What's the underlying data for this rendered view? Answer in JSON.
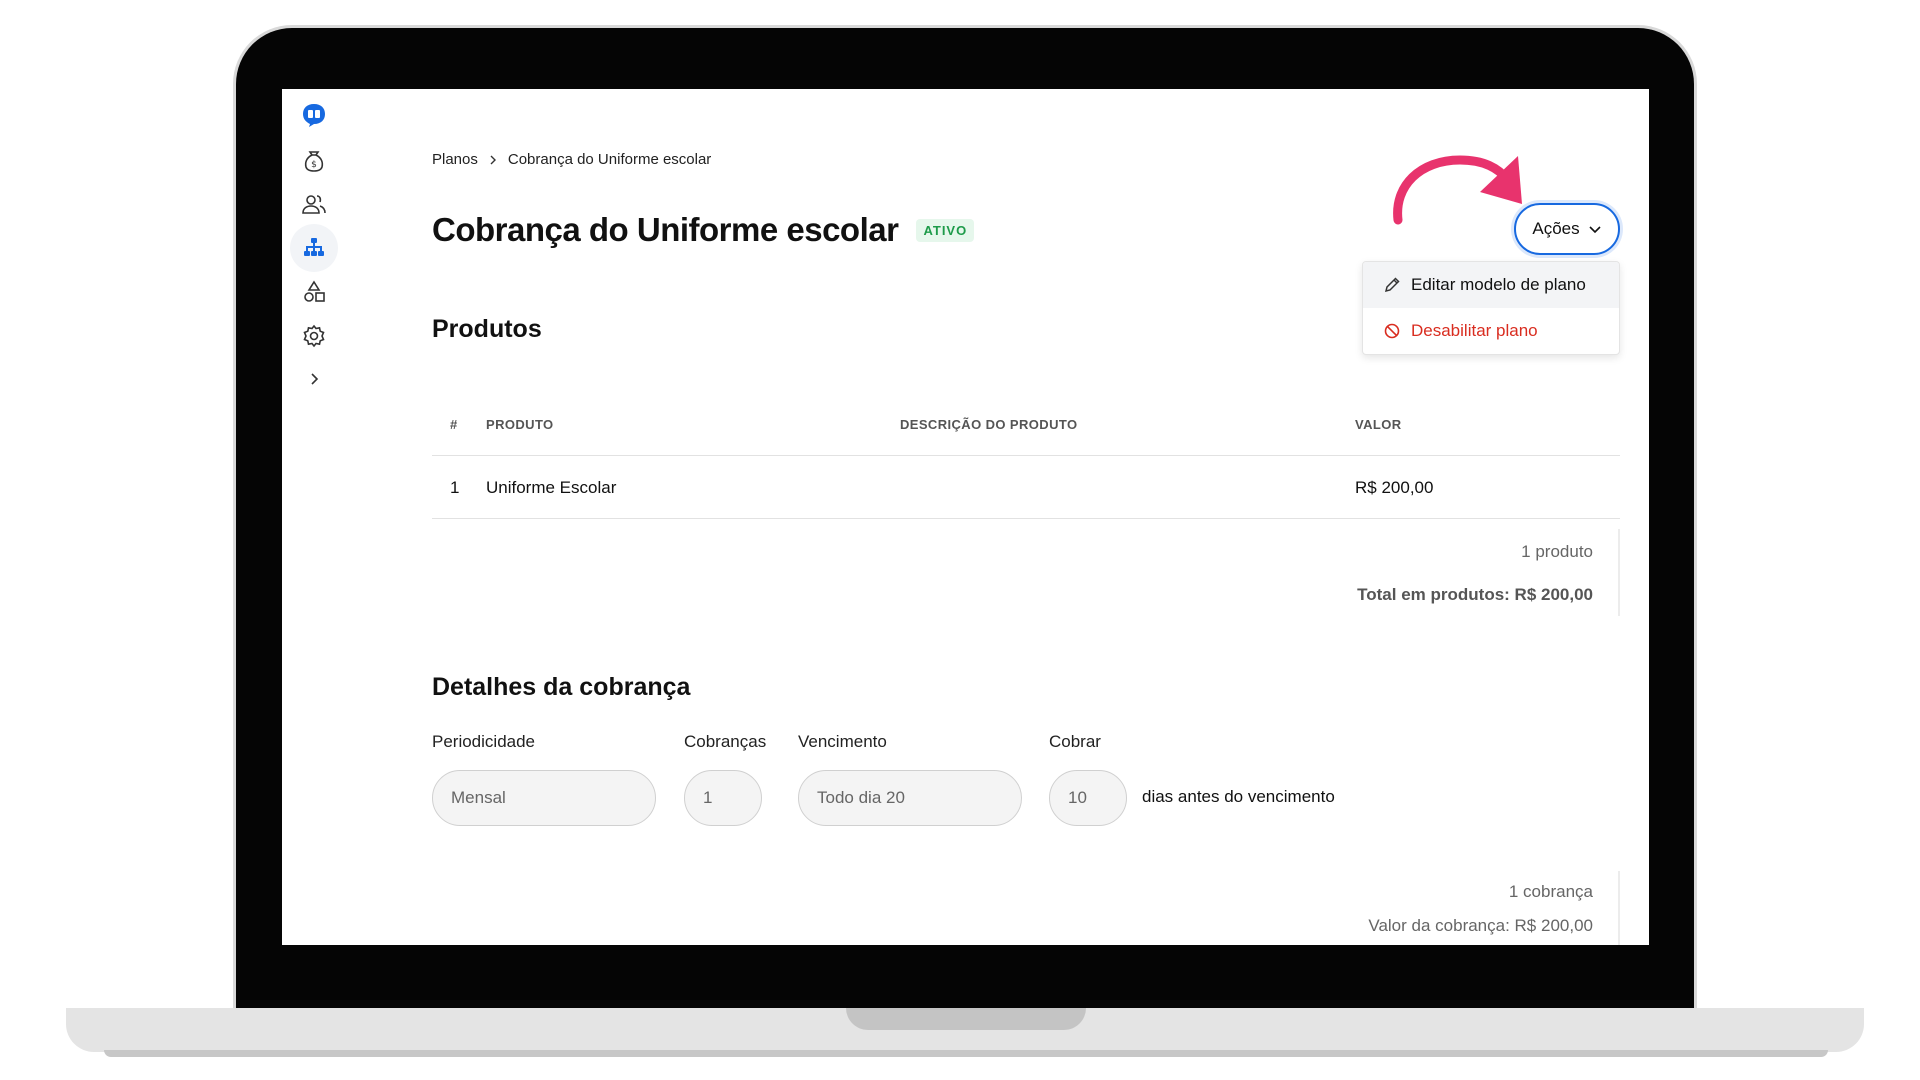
{
  "breadcrumb": {
    "items": [
      "Planos",
      "Cobrança do Uniforme escolar"
    ]
  },
  "page": {
    "title": "Cobrança do Uniforme escolar",
    "status": "ATIVO"
  },
  "actions": {
    "label": "Ações",
    "menu": [
      {
        "label": "Editar modelo de plano",
        "icon": "pencil-icon"
      },
      {
        "label": "Desabilitar plano",
        "icon": "ban-icon"
      }
    ]
  },
  "products": {
    "title": "Produtos",
    "columns": [
      "#",
      "PRODUTO",
      "DESCRIÇÃO DO PRODUTO",
      "VALOR"
    ],
    "rows": [
      {
        "index": "1",
        "product": "Uniforme Escolar",
        "description": "",
        "value": "R$ 200,00"
      }
    ],
    "count_text": "1 produto",
    "total_text": "Total em produtos: R$ 200,00"
  },
  "billing": {
    "title": "Detalhes da cobrança",
    "fields": [
      {
        "label": "Periodicidade",
        "value": "Mensal"
      },
      {
        "label": "Cobranças",
        "value": "1"
      },
      {
        "label": "Vencimento",
        "value": "Todo dia 20"
      },
      {
        "label": "Cobrar",
        "value": "10"
      }
    ],
    "suffix": "dias antes do vencimento",
    "count_text": "1 cobrança",
    "value_text": "Valor da cobrança: R$ 200,00"
  },
  "sidebar": {
    "icons": [
      "logo-icon",
      "money-bag-icon",
      "users-icon",
      "hierarchy-icon",
      "shapes-icon",
      "gear-icon",
      "chevron-right-icon"
    ],
    "active": "hierarchy-icon"
  },
  "colors": {
    "accent": "#1769e0",
    "success": "#1e9b4a",
    "danger": "#d92d20",
    "annotation": "#e8336d"
  }
}
